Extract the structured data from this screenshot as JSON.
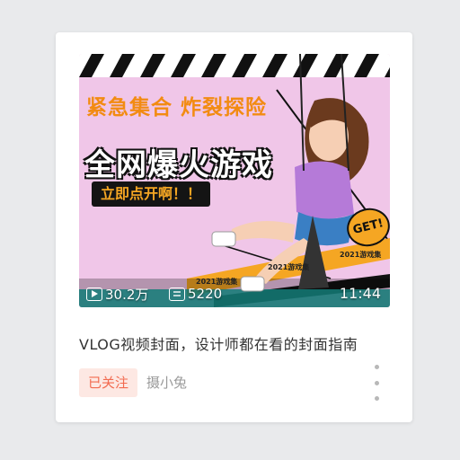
{
  "card": {
    "thumbnail": {
      "headline_line1": "紧急集合 炸裂探险",
      "headline_line2": "全网爆火游戏",
      "cta_label": "立即点开啊！！",
      "badge_text": "GET!",
      "tape_text": "2021游戏集",
      "views": "30.2万",
      "danmaku_count": "5220",
      "duration": "11:44",
      "icons": [
        "play-icon",
        "danmaku-icon"
      ]
    },
    "title": "VLOG视频封面，设计师都在看的封面指南",
    "follow_status": "已关注",
    "author": "摄小兔",
    "more_icon": "more-vertical-icon"
  },
  "colors": {
    "accent_orange": "#f28b12",
    "follow_bg": "#fde8e3",
    "follow_text": "#f26a4f",
    "thumb_bg": "#f0c6e8"
  }
}
